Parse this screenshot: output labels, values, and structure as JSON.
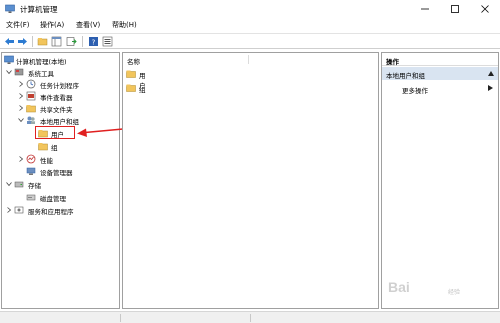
{
  "window": {
    "title": "计算机管理",
    "controls": {
      "minimize": "minimize",
      "maximize": "maximize",
      "close": "close"
    }
  },
  "menu": {
    "file": "文件(F)",
    "action": "操作(A)",
    "view": "查看(V)",
    "help": "帮助(H)"
  },
  "toolbar": {
    "icons": [
      "back-arrow-icon",
      "forward-arrow-icon",
      "folder-up-icon",
      "show-tree-icon",
      "export-icon",
      "help-icon",
      "properties-icon"
    ]
  },
  "tree": {
    "root": "计算机管理(本地)",
    "system_tools": "系统工具",
    "task_scheduler": "任务计划程序",
    "event_viewer": "事件查看器",
    "shared_folders": "共享文件夹",
    "local_users_groups": "本地用户和组",
    "users": "用户",
    "groups": "组",
    "performance": "性能",
    "device_manager": "设备管理器",
    "storage": "存储",
    "disk_management": "磁盘管理",
    "services_apps": "服务和应用程序"
  },
  "list": {
    "header_name": "名称",
    "items": [
      "用户",
      "组"
    ]
  },
  "actions": {
    "title": "操作",
    "section": "本地用户和组",
    "more": "更多操作"
  },
  "watermark": {
    "brand": "Bai",
    "sub": "经验"
  },
  "colors": {
    "annotation_red": "#e02020",
    "selection_blue": "#d9e4f1",
    "folder_yellow": "#f2c55c"
  }
}
